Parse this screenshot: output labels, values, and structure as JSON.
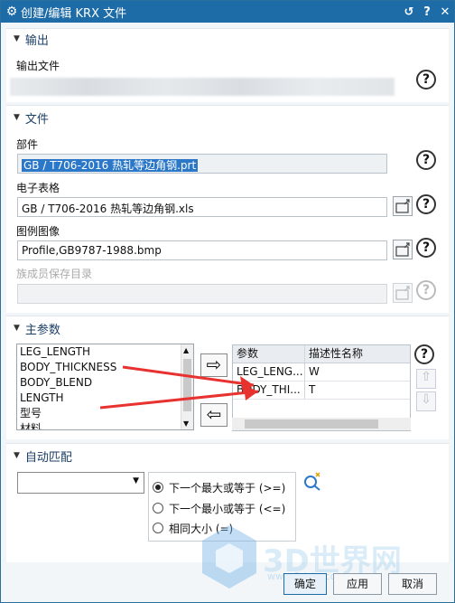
{
  "window": {
    "title": "创建/编辑 KRX 文件",
    "buttons": [
      "↺",
      "?",
      "✕"
    ]
  },
  "output_section": {
    "title": "输出",
    "field_label": "输出文件",
    "field_value": ""
  },
  "file_section": {
    "title": "文件",
    "part_label": "部件",
    "part_value": "GB / T706-2016 热轧等边角钢.prt",
    "spreadsheet_label": "电子表格",
    "spreadsheet_value": "GB / T706-2016 热轧等边角钢.xls",
    "image_label": "图例图像",
    "image_value": "Profile,GB9787-1988.bmp",
    "family_dir_label": "族成员保存目录",
    "family_dir_value": ""
  },
  "main_params": {
    "title": "主参数",
    "list_items": [
      "LEG_LENGTH",
      "BODY_THICKNESS",
      "BODY_BLEND",
      "LENGTH",
      "型号",
      "材料"
    ],
    "table_headers": [
      "参数",
      "描述性名称"
    ],
    "table_rows": [
      {
        "param": "LEG_LENG...",
        "name": "W"
      },
      {
        "param": "BODY_THI...",
        "name": "T"
      }
    ]
  },
  "auto_match": {
    "title": "自动匹配",
    "dropdown_value": "",
    "options": [
      "下一个最大或等于 (>=)",
      "下一个最小或等于 (<=)",
      "相同大小 (=)"
    ],
    "selected_index": 0
  },
  "footer": {
    "ok": "确定",
    "apply": "应用",
    "cancel": "取消"
  },
  "watermark": {
    "text": "3D世界网",
    "small": "www.3dsjw.com"
  },
  "colors": {
    "titlebar": "#1d6ca7",
    "section_title": "#1c3f66",
    "selection": "#2b78c9",
    "annotation_arrow": "#e8322f"
  }
}
